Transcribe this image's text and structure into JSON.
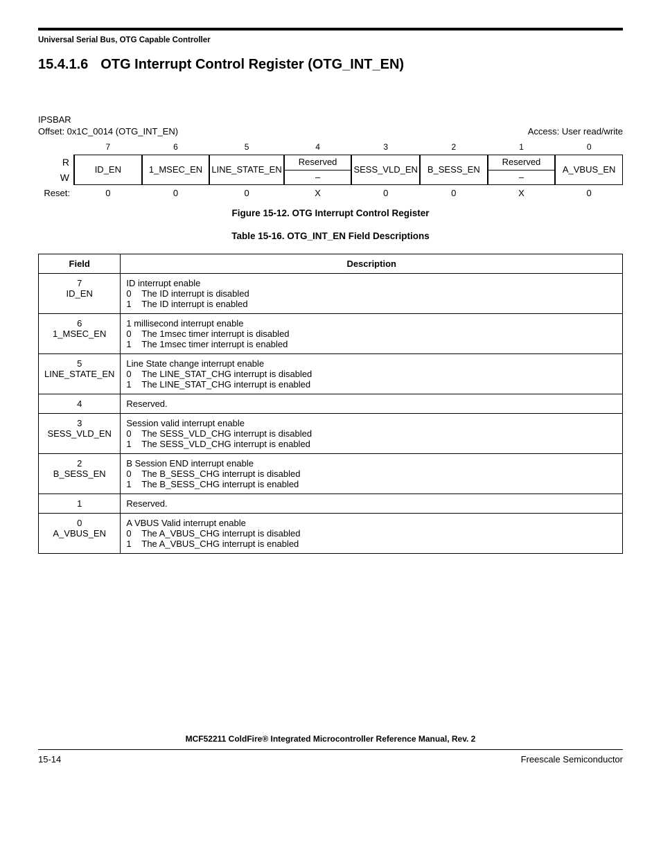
{
  "running_head": "Universal Serial Bus, OTG Capable Controller",
  "section": {
    "number": "15.4.1.6",
    "title": "OTG Interrupt Control Register (OTG_INT_EN)"
  },
  "register": {
    "ipsbar": "IPSBAR",
    "offset": "Offset: 0x1C_0014 (OTG_INT_EN)",
    "access": "Access: User read/write",
    "bit_numbers": [
      "7",
      "6",
      "5",
      "4",
      "3",
      "2",
      "1",
      "0"
    ],
    "rw_r": "R",
    "rw_w": "W",
    "reset_label": "Reset:",
    "fields": [
      {
        "name": "ID_EN",
        "reset": "0",
        "split": false
      },
      {
        "name": "1_MSEC_EN",
        "reset": "0",
        "split": false
      },
      {
        "name": "LINE_STATE_EN",
        "reset": "0",
        "split": false
      },
      {
        "name": "Reserved",
        "reset": "X",
        "split": true,
        "bot": "–"
      },
      {
        "name": "SESS_VLD_EN",
        "reset": "0",
        "split": false
      },
      {
        "name": "B_SESS_EN",
        "reset": "0",
        "split": false
      },
      {
        "name": "Reserved",
        "reset": "X",
        "split": true,
        "bot": "–"
      },
      {
        "name": "A_VBUS_EN",
        "reset": "0",
        "split": false
      }
    ]
  },
  "figure_caption": "Figure 15-12. OTG Interrupt Control Register",
  "table_caption": "Table 15-16. OTG_INT_EN Field Descriptions",
  "desc_table": {
    "headers": {
      "field": "Field",
      "description": "Description"
    },
    "rows": [
      {
        "field": "7\nID_EN",
        "title": "ID interrupt enable",
        "opts": [
          [
            "0",
            "The ID interrupt is disabled"
          ],
          [
            "1",
            "The ID interrupt is enabled"
          ]
        ]
      },
      {
        "field": "6\n1_MSEC_EN",
        "title": "1 millisecond interrupt enable",
        "opts": [
          [
            "0",
            "The 1msec timer interrupt is disabled"
          ],
          [
            "1",
            "The 1msec timer interrupt is enabled"
          ]
        ]
      },
      {
        "field": "5\nLINE_STATE_EN",
        "title": "Line State change interrupt enable",
        "opts": [
          [
            "0",
            "The LINE_STAT_CHG interrupt is disabled"
          ],
          [
            "1",
            "The LINE_STAT_CHG interrupt is enabled"
          ]
        ]
      },
      {
        "field": "4",
        "title": "Reserved.",
        "opts": []
      },
      {
        "field": "3\nSESS_VLD_EN",
        "title": "Session valid interrupt enable",
        "opts": [
          [
            "0",
            "The SESS_VLD_CHG interrupt is disabled"
          ],
          [
            "1",
            "The SESS_VLD_CHG interrupt is enabled"
          ]
        ]
      },
      {
        "field": "2\nB_SESS_EN",
        "title": "B Session END interrupt enable",
        "opts": [
          [
            "0",
            "The B_SESS_CHG interrupt is disabled"
          ],
          [
            "1",
            "The B_SESS_CHG interrupt is enabled"
          ]
        ]
      },
      {
        "field": "1",
        "title": "Reserved.",
        "opts": []
      },
      {
        "field": "0\nA_VBUS_EN",
        "title": "A VBUS Valid interrupt enable",
        "opts": [
          [
            "0",
            "The A_VBUS_CHG interrupt is disabled"
          ],
          [
            "1",
            "The A_VBUS_CHG interrupt is enabled"
          ]
        ]
      }
    ]
  },
  "footer": {
    "manual": "MCF52211 ColdFire® Integrated Microcontroller Reference Manual, Rev. 2",
    "page": "15-14",
    "company": "Freescale Semiconductor"
  }
}
